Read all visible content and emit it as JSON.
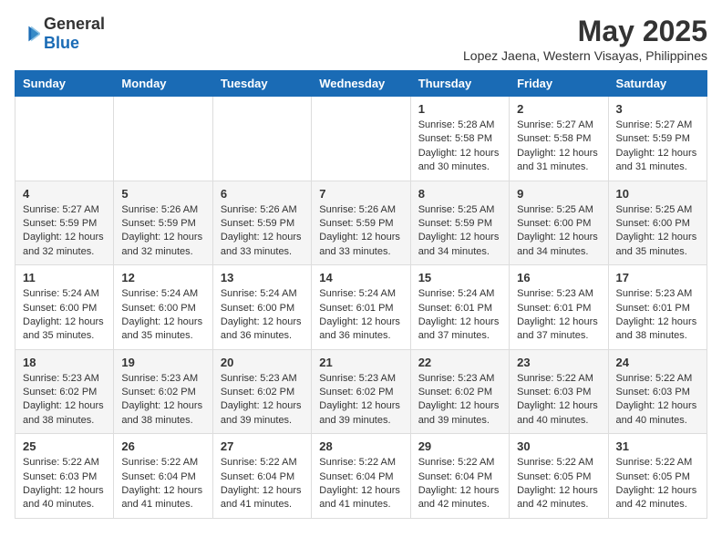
{
  "logo": {
    "general": "General",
    "blue": "Blue"
  },
  "title": "May 2025",
  "location": "Lopez Jaena, Western Visayas, Philippines",
  "days_of_week": [
    "Sunday",
    "Monday",
    "Tuesday",
    "Wednesday",
    "Thursday",
    "Friday",
    "Saturday"
  ],
  "weeks": [
    [
      {
        "day": "",
        "info": ""
      },
      {
        "day": "",
        "info": ""
      },
      {
        "day": "",
        "info": ""
      },
      {
        "day": "",
        "info": ""
      },
      {
        "day": "1",
        "info": "Sunrise: 5:28 AM\nSunset: 5:58 PM\nDaylight: 12 hours and 30 minutes."
      },
      {
        "day": "2",
        "info": "Sunrise: 5:27 AM\nSunset: 5:58 PM\nDaylight: 12 hours and 31 minutes."
      },
      {
        "day": "3",
        "info": "Sunrise: 5:27 AM\nSunset: 5:59 PM\nDaylight: 12 hours and 31 minutes."
      }
    ],
    [
      {
        "day": "4",
        "info": "Sunrise: 5:27 AM\nSunset: 5:59 PM\nDaylight: 12 hours and 32 minutes."
      },
      {
        "day": "5",
        "info": "Sunrise: 5:26 AM\nSunset: 5:59 PM\nDaylight: 12 hours and 32 minutes."
      },
      {
        "day": "6",
        "info": "Sunrise: 5:26 AM\nSunset: 5:59 PM\nDaylight: 12 hours and 33 minutes."
      },
      {
        "day": "7",
        "info": "Sunrise: 5:26 AM\nSunset: 5:59 PM\nDaylight: 12 hours and 33 minutes."
      },
      {
        "day": "8",
        "info": "Sunrise: 5:25 AM\nSunset: 5:59 PM\nDaylight: 12 hours and 34 minutes."
      },
      {
        "day": "9",
        "info": "Sunrise: 5:25 AM\nSunset: 6:00 PM\nDaylight: 12 hours and 34 minutes."
      },
      {
        "day": "10",
        "info": "Sunrise: 5:25 AM\nSunset: 6:00 PM\nDaylight: 12 hours and 35 minutes."
      }
    ],
    [
      {
        "day": "11",
        "info": "Sunrise: 5:24 AM\nSunset: 6:00 PM\nDaylight: 12 hours and 35 minutes."
      },
      {
        "day": "12",
        "info": "Sunrise: 5:24 AM\nSunset: 6:00 PM\nDaylight: 12 hours and 35 minutes."
      },
      {
        "day": "13",
        "info": "Sunrise: 5:24 AM\nSunset: 6:00 PM\nDaylight: 12 hours and 36 minutes."
      },
      {
        "day": "14",
        "info": "Sunrise: 5:24 AM\nSunset: 6:01 PM\nDaylight: 12 hours and 36 minutes."
      },
      {
        "day": "15",
        "info": "Sunrise: 5:24 AM\nSunset: 6:01 PM\nDaylight: 12 hours and 37 minutes."
      },
      {
        "day": "16",
        "info": "Sunrise: 5:23 AM\nSunset: 6:01 PM\nDaylight: 12 hours and 37 minutes."
      },
      {
        "day": "17",
        "info": "Sunrise: 5:23 AM\nSunset: 6:01 PM\nDaylight: 12 hours and 38 minutes."
      }
    ],
    [
      {
        "day": "18",
        "info": "Sunrise: 5:23 AM\nSunset: 6:02 PM\nDaylight: 12 hours and 38 minutes."
      },
      {
        "day": "19",
        "info": "Sunrise: 5:23 AM\nSunset: 6:02 PM\nDaylight: 12 hours and 38 minutes."
      },
      {
        "day": "20",
        "info": "Sunrise: 5:23 AM\nSunset: 6:02 PM\nDaylight: 12 hours and 39 minutes."
      },
      {
        "day": "21",
        "info": "Sunrise: 5:23 AM\nSunset: 6:02 PM\nDaylight: 12 hours and 39 minutes."
      },
      {
        "day": "22",
        "info": "Sunrise: 5:23 AM\nSunset: 6:02 PM\nDaylight: 12 hours and 39 minutes."
      },
      {
        "day": "23",
        "info": "Sunrise: 5:22 AM\nSunset: 6:03 PM\nDaylight: 12 hours and 40 minutes."
      },
      {
        "day": "24",
        "info": "Sunrise: 5:22 AM\nSunset: 6:03 PM\nDaylight: 12 hours and 40 minutes."
      }
    ],
    [
      {
        "day": "25",
        "info": "Sunrise: 5:22 AM\nSunset: 6:03 PM\nDaylight: 12 hours and 40 minutes."
      },
      {
        "day": "26",
        "info": "Sunrise: 5:22 AM\nSunset: 6:04 PM\nDaylight: 12 hours and 41 minutes."
      },
      {
        "day": "27",
        "info": "Sunrise: 5:22 AM\nSunset: 6:04 PM\nDaylight: 12 hours and 41 minutes."
      },
      {
        "day": "28",
        "info": "Sunrise: 5:22 AM\nSunset: 6:04 PM\nDaylight: 12 hours and 41 minutes."
      },
      {
        "day": "29",
        "info": "Sunrise: 5:22 AM\nSunset: 6:04 PM\nDaylight: 12 hours and 42 minutes."
      },
      {
        "day": "30",
        "info": "Sunrise: 5:22 AM\nSunset: 6:05 PM\nDaylight: 12 hours and 42 minutes."
      },
      {
        "day": "31",
        "info": "Sunrise: 5:22 AM\nSunset: 6:05 PM\nDaylight: 12 hours and 42 minutes."
      }
    ]
  ]
}
